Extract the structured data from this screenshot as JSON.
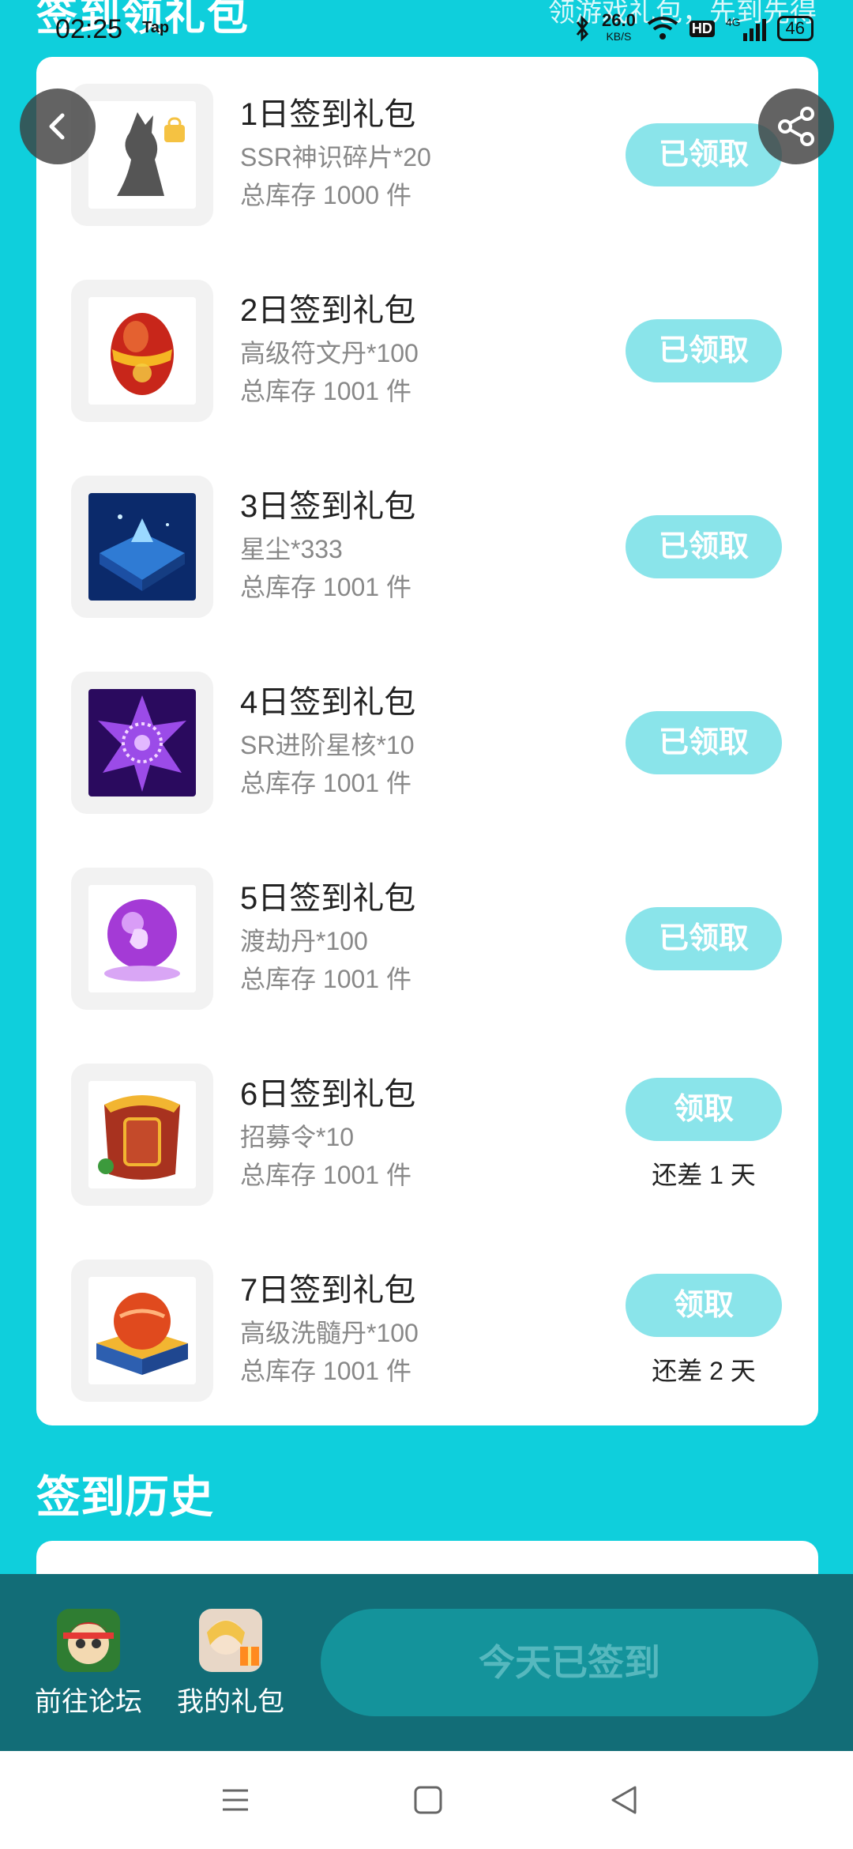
{
  "status_bar": {
    "time": "02:25",
    "app_badge": "Tap",
    "speed_value": "26.0",
    "speed_unit": "KB/S",
    "hd": "HD",
    "network": "4G",
    "battery": "46"
  },
  "header": {
    "title": "签到领礼包",
    "subtitle": "领游戏礼包，先到先得"
  },
  "gifts": [
    {
      "title": "1日签到礼包",
      "desc": "SSR神识碎片*20",
      "stock": "总库存 1000 件",
      "button": "已领取",
      "days_left": ""
    },
    {
      "title": "2日签到礼包",
      "desc": "高级符文丹*100",
      "stock": "总库存 1001 件",
      "button": "已领取",
      "days_left": ""
    },
    {
      "title": "3日签到礼包",
      "desc": "星尘*333",
      "stock": "总库存 1001 件",
      "button": "已领取",
      "days_left": ""
    },
    {
      "title": "4日签到礼包",
      "desc": "SR进阶星核*10",
      "stock": "总库存 1001 件",
      "button": "已领取",
      "days_left": ""
    },
    {
      "title": "5日签到礼包",
      "desc": "渡劫丹*100",
      "stock": "总库存 1001 件",
      "button": "已领取",
      "days_left": ""
    },
    {
      "title": "6日签到礼包",
      "desc": "招募令*10",
      "stock": "总库存 1001 件",
      "button": "领取",
      "days_left": "还差 1 天"
    },
    {
      "title": "7日签到礼包",
      "desc": "高级洗髓丹*100",
      "stock": "总库存 1001 件",
      "button": "领取",
      "days_left": "还差 2 天"
    }
  ],
  "history": {
    "heading": "签到历史"
  },
  "bottom_bar": {
    "forum_label": "前往论坛",
    "my_gifts_label": "我的礼包",
    "signin_label": "今天已签到"
  },
  "colors": {
    "background": "#0fcfdc",
    "claim_button": "#8ae4ea",
    "bottom_bar": "#126d77"
  }
}
